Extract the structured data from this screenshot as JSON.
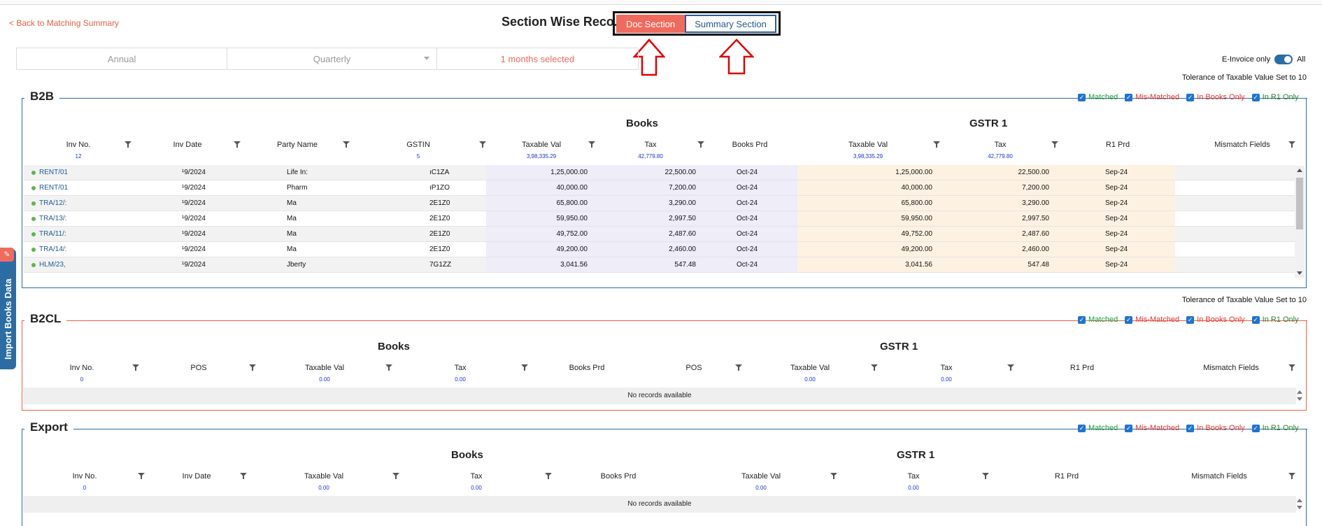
{
  "header": {
    "back_label": "< Back to Matching Summary",
    "title": "Section Wise Reco.",
    "doc_section_label": "Doc Section",
    "summary_section_label": "Summary Section"
  },
  "filters": {
    "annual": "Annual",
    "quarterly": "Quarterly",
    "months": "1 months selected",
    "einvoice_label": "E-Invoice only",
    "all_label": "All"
  },
  "tolerance_text": "Tolerance of Taxable Value Set to 10",
  "legend": {
    "matched": "Matched",
    "mismatched": "Mis-Matched",
    "books_only": "In Books Only",
    "r1_only": "In R1 Only"
  },
  "b2b": {
    "title": "B2B",
    "books_group": "Books",
    "gstr_group": "GSTR 1",
    "columns": {
      "inv_no": "Inv No.",
      "inv_date": "Inv Date",
      "party_name": "Party Name",
      "gstin": "GSTIN",
      "taxable_val": "Taxable Val",
      "tax": "Tax",
      "books_prd": "Books Prd",
      "gstr_taxable_val": "Taxable Val",
      "gstr_tax": "Tax",
      "r1_prd": "R1 Prd",
      "mismatch_fields": "Mismatch Fields"
    },
    "sums": {
      "inv_count": "12",
      "gstin_count": "5",
      "taxable_val": "3,98,335.29",
      "tax": "42,779.80",
      "gstr_taxable_val": "3,98,335.29",
      "gstr_tax": "42,779.80"
    },
    "rows": [
      {
        "inv": "RENT/01",
        "date": "¹9/2024",
        "party": "Life In:",
        "gstin": "ıC1ZA",
        "taxable": "1,25,000.00",
        "tax": "22,500.00",
        "bprd": "Oct-24",
        "g_taxable": "1,25,000.00",
        "g_tax": "22,500.00",
        "rprd": "Sep-24"
      },
      {
        "inv": "RENT/01",
        "date": "¹9/2024",
        "party": "Pharm",
        "gstin": "ıP1ZO",
        "taxable": "40,000.00",
        "tax": "7,200.00",
        "bprd": "Oct-24",
        "g_taxable": "40,000.00",
        "g_tax": "7,200.00",
        "rprd": "Sep-24"
      },
      {
        "inv": "TRA/12/:",
        "date": "¹9/2024",
        "party": "Ma",
        "gstin": "2E1Z0",
        "taxable": "65,800.00",
        "tax": "3,290.00",
        "bprd": "Oct-24",
        "g_taxable": "65,800.00",
        "g_tax": "3,290.00",
        "rprd": "Sep-24"
      },
      {
        "inv": "TRA/13/:",
        "date": "¹9/2024",
        "party": "Ma",
        "gstin": "2E1Z0",
        "taxable": "59,950.00",
        "tax": "2,997.50",
        "bprd": "Oct-24",
        "g_taxable": "59,950.00",
        "g_tax": "2,997.50",
        "rprd": "Sep-24"
      },
      {
        "inv": "TRA/11/:",
        "date": "¹9/2024",
        "party": "Ma",
        "gstin": "2E1Z0",
        "taxable": "49,752.00",
        "tax": "2,487.60",
        "bprd": "Oct-24",
        "g_taxable": "49,752.00",
        "g_tax": "2,487.60",
        "rprd": "Sep-24"
      },
      {
        "inv": "TRA/14/:",
        "date": "¹9/2024",
        "party": "Ma",
        "gstin": "2E1Z0",
        "taxable": "49,200.00",
        "tax": "2,460.00",
        "bprd": "Oct-24",
        "g_taxable": "49,200.00",
        "g_tax": "2,460.00",
        "rprd": "Sep-24"
      },
      {
        "inv": "HLM/23,",
        "date": "¹9/2024",
        "party": "Jberty",
        "gstin": "7G1ZZ",
        "taxable": "3,041.56",
        "tax": "547.48",
        "bprd": "Oct-24",
        "g_taxable": "3,041.56",
        "g_tax": "547.48",
        "rprd": "Sep-24"
      }
    ]
  },
  "b2cl": {
    "title": "B2CL",
    "books_group": "Books",
    "gstr_group": "GSTR 1",
    "columns": {
      "inv_no": "Inv No.",
      "pos": "POS",
      "taxable_val": "Taxable Val",
      "tax": "Tax",
      "books_prd": "Books Prd",
      "gstr_pos": "POS",
      "gstr_taxable_val": "Taxable Val",
      "gstr_tax": "Tax",
      "r1_prd": "R1 Prd",
      "mismatch_fields": "Mismatch Fields"
    },
    "sums": {
      "inv_count": "0",
      "taxable_val": "0.00",
      "tax": "0.00",
      "gstr_taxable_val": "0.00",
      "gstr_tax": "0.00"
    },
    "empty_text": "No records available"
  },
  "export": {
    "title": "Export",
    "books_group": "Books",
    "gstr_group": "GSTR 1",
    "columns": {
      "inv_no": "Inv No.",
      "inv_date": "Inv Date",
      "taxable_val": "Taxable Val",
      "tax": "Tax",
      "books_prd": "Books Prd",
      "gstr_taxable_val": "Taxable Val",
      "gstr_tax": "Tax",
      "r1_prd": "R1 Prd",
      "mismatch_fields": "Mismatch Fields"
    },
    "sums": {
      "inv_count": "0",
      "taxable_val": "0.00",
      "tax": "0.00",
      "gstr_taxable_val": "0.00",
      "gstr_tax": "0.00"
    },
    "empty_text": "No records available"
  },
  "side_tab": {
    "label": "Import Books Data",
    "icon": "megaphone-icon"
  },
  "colors": {
    "accent": "#f06b5e",
    "primary": "#2b6ca3",
    "matched": "#1b9e3a",
    "mismatched": "#e8322f"
  }
}
